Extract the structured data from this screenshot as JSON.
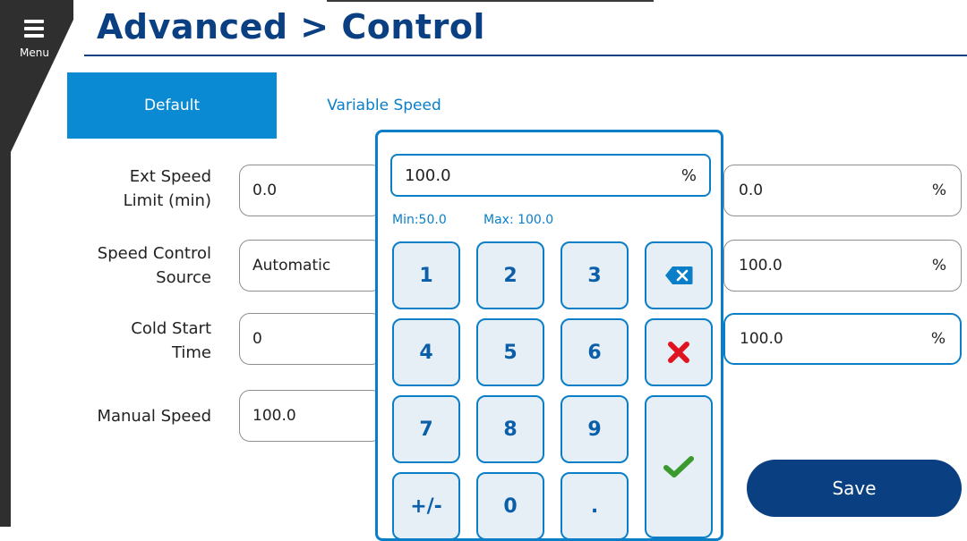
{
  "menu": {
    "label": "Menu"
  },
  "header": {
    "title": "Advanced > Control"
  },
  "tabs": [
    {
      "label": "Default",
      "active": true
    },
    {
      "label": "Variable Speed",
      "active": false
    }
  ],
  "rows": [
    {
      "label": "Ext Speed Limit (min)",
      "left_value": "0.0",
      "right_value": "0.0",
      "right_unit": "%"
    },
    {
      "label": "Speed Control Source",
      "left_value": "Automatic",
      "right_value": "100.0",
      "right_unit": "%"
    },
    {
      "label": "Cold Start Time",
      "left_value": "0",
      "right_value": "100.0",
      "right_unit": "%"
    },
    {
      "label": "Manual Speed",
      "left_value": "100.0"
    }
  ],
  "keypad": {
    "display_value": "100.0",
    "unit": "%",
    "min_label": "Min:50.0",
    "max_label": "Max:  100.0",
    "keys": [
      "1",
      "2",
      "3",
      "4",
      "5",
      "6",
      "7",
      "8",
      "9",
      "+/-",
      "0",
      "."
    ],
    "backspace_icon": "backspace-icon",
    "cancel_icon": "cancel-x-icon",
    "enter_icon": "checkmark-icon"
  },
  "actions": {
    "save_label": "Save"
  },
  "colors": {
    "title": "#0a3f82",
    "tab_active": "#0a8ad2",
    "accent": "#0a7fc8",
    "key_bg": "#e6eef6",
    "cancel": "#e0141e",
    "confirm": "#3a9a2e",
    "save": "#0a3f82"
  }
}
